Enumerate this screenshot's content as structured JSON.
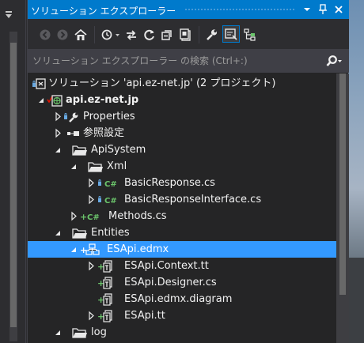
{
  "colors": {
    "accent": "#007acc",
    "selection": "#3399ff",
    "panel_bg": "#252526",
    "folder": "#c8c8c8",
    "csharp": "#6bc46b",
    "lock": "#68a9e2",
    "add": "#6bc46b"
  },
  "panel": {
    "title": "ソリューション エクスプローラー",
    "title_buttons": {
      "dropdown_icon": "chevron-down",
      "pin_icon": "pin",
      "close_icon": "close"
    }
  },
  "toolbar": {
    "buttons": [
      "back",
      "forward",
      "home",
      "history",
      "sync",
      "refresh",
      "collapse-all",
      "show-all-files",
      "properties",
      "preview-selected",
      "class-view"
    ]
  },
  "search": {
    "placeholder": "ソリューション エクスプローラー の検索 (Ctrl+:)",
    "value": "",
    "icon": "search"
  },
  "tree": {
    "rows": [
      {
        "label": "ソリューション 'api.ez-net.jp' (2 プロジェクト)",
        "icon": "solution",
        "bold": false
      },
      {
        "label": "api.ez-net.jp",
        "icon": "web-project",
        "bold": true
      },
      {
        "label": "Properties",
        "icon": "wrench"
      },
      {
        "label": "参照設定",
        "icon": "references"
      },
      {
        "label": "ApiSystem",
        "icon": "folder"
      },
      {
        "label": "Xml",
        "icon": "folder"
      },
      {
        "label": "BasicResponse.cs",
        "icon": "csharp-file"
      },
      {
        "label": "BasicResponseInterface.cs",
        "icon": "csharp-file"
      },
      {
        "label": "Methods.cs",
        "icon": "csharp-file"
      },
      {
        "label": "Entities",
        "icon": "folder"
      },
      {
        "label": "ESApi.edmx",
        "icon": "edmx-file",
        "selected": true
      },
      {
        "label": "ESApi.Context.tt",
        "icon": "tt-file"
      },
      {
        "label": "ESApi.Designer.cs",
        "icon": "tt-file"
      },
      {
        "label": "ESApi.edmx.diagram",
        "icon": "tt-file"
      },
      {
        "label": "ESApi.tt",
        "icon": "tt-file"
      },
      {
        "label": "log",
        "icon": "folder"
      }
    ]
  }
}
